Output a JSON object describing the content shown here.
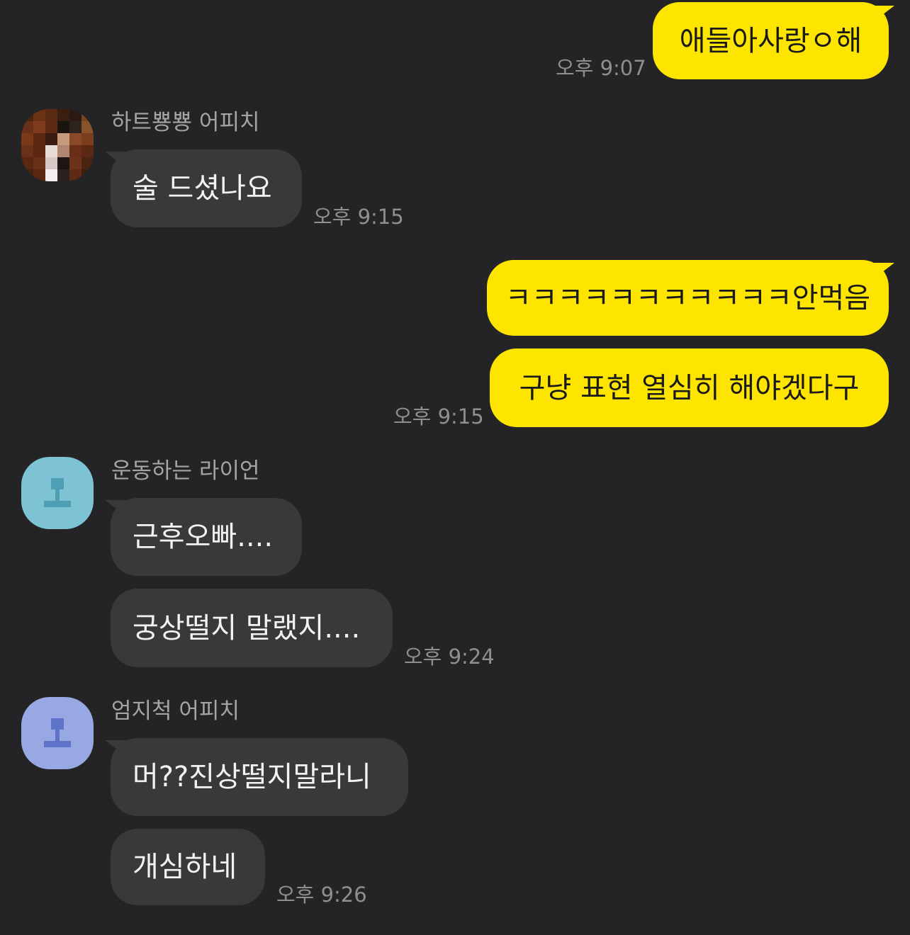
{
  "colors": {
    "background": "#242426",
    "my_bubble": "#FEE500",
    "their_bubble": "#39393b",
    "avatar_teal": "#7dc3d3",
    "avatar_blue": "#97a8e2"
  },
  "messages": {
    "m1": {
      "text": "애들아사랑ㅇ해",
      "time": "오후 9:07"
    },
    "m2": {
      "sender": "하트뿅뿅 어피치",
      "text": "술 드셨나요",
      "time": "오후 9:15",
      "avatar": "pixelated-photo-avatar"
    },
    "m3": {
      "text": "ㅋㅋㅋㅋㅋㅋㅋㅋㅋㅋㅋ안먹음"
    },
    "m4": {
      "text": "구냥 표현 열심히 해야겠다구",
      "time": "오후 9:15"
    },
    "m5": {
      "sender": "운동하는 라이언",
      "text": "근후오빠....",
      "avatar": "default-profile-icon"
    },
    "m6": {
      "text": "궁상떨지 말랬지....",
      "time": "오후 9:24"
    },
    "m7": {
      "sender": "엄지척 어피치",
      "text": "머??진상떨지말라니",
      "avatar": "default-profile-icon"
    },
    "m8": {
      "text": "개심하네",
      "time": "오후 9:26"
    }
  }
}
